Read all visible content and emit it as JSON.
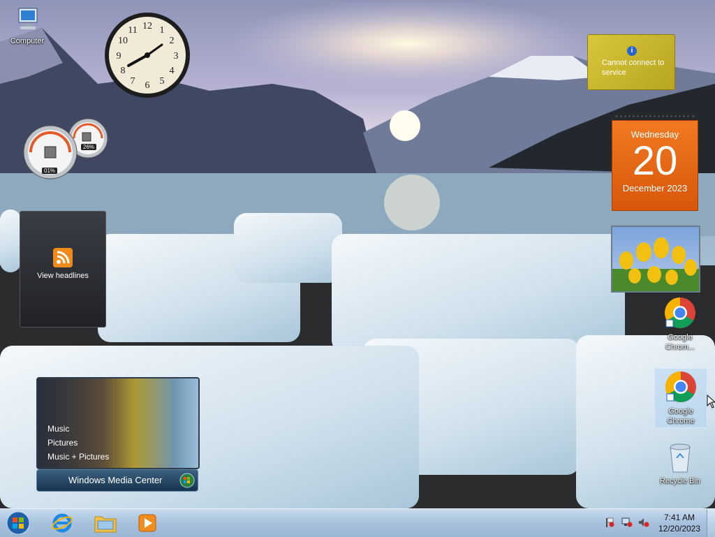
{
  "desktop_icons": {
    "computer": "Computer",
    "chrome1": "Google Chrom...",
    "chrome2": "Google Chrome",
    "recycle": "Recycle Bin"
  },
  "gadgets": {
    "clock_numbers": [
      "12",
      "1",
      "2",
      "3",
      "4",
      "5",
      "6",
      "7",
      "8",
      "9",
      "10",
      "11"
    ],
    "cpu_meter": {
      "cpu": "01%",
      "memory": "26%"
    },
    "currency": {
      "message": "Cannot connect to service"
    },
    "calendar": {
      "weekday": "Wednesday",
      "day": "20",
      "month_year": "December 2023"
    },
    "feed": {
      "label": "View headlines"
    },
    "media_center": {
      "menu": [
        "Music",
        "Pictures",
        "Music + Pictures"
      ],
      "brand": "Windows Media Center"
    }
  },
  "taskbar": {
    "time": "7:41 AM",
    "date": "12/20/2023"
  },
  "colors": {
    "calendar_orange": "#e2620d",
    "taskbar": "#a9c3df",
    "currency_gold": "#c7b52a"
  }
}
